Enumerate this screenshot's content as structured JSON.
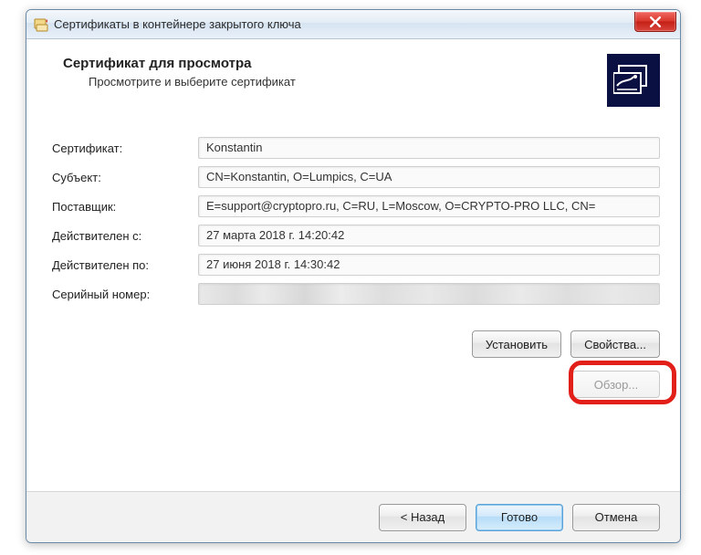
{
  "window": {
    "title": "Сертификаты в контейнере закрытого ключа"
  },
  "header": {
    "title": "Сертификат для просмотра",
    "subtitle": "Просмотрите и выберите сертификат"
  },
  "labels": {
    "certificate": "Сертификат:",
    "subject": "Субъект:",
    "issuer": "Поставщик:",
    "valid_from": "Действителен с:",
    "valid_to": "Действителен по:",
    "serial": "Серийный номер:"
  },
  "values": {
    "certificate": "Konstantin",
    "subject": "CN=Konstantin, O=Lumpics, C=UA",
    "issuer": "E=support@cryptopro.ru, C=RU, L=Moscow, O=CRYPTO-PRO LLC, CN=",
    "valid_from": "27 марта 2018 г. 14:20:42",
    "valid_to": "27 июня 2018 г. 14:30:42",
    "serial": ""
  },
  "buttons": {
    "install": "Установить",
    "properties": "Свойства...",
    "browse": "Обзор...",
    "back": "< Назад",
    "finish": "Готово",
    "cancel": "Отмена"
  }
}
